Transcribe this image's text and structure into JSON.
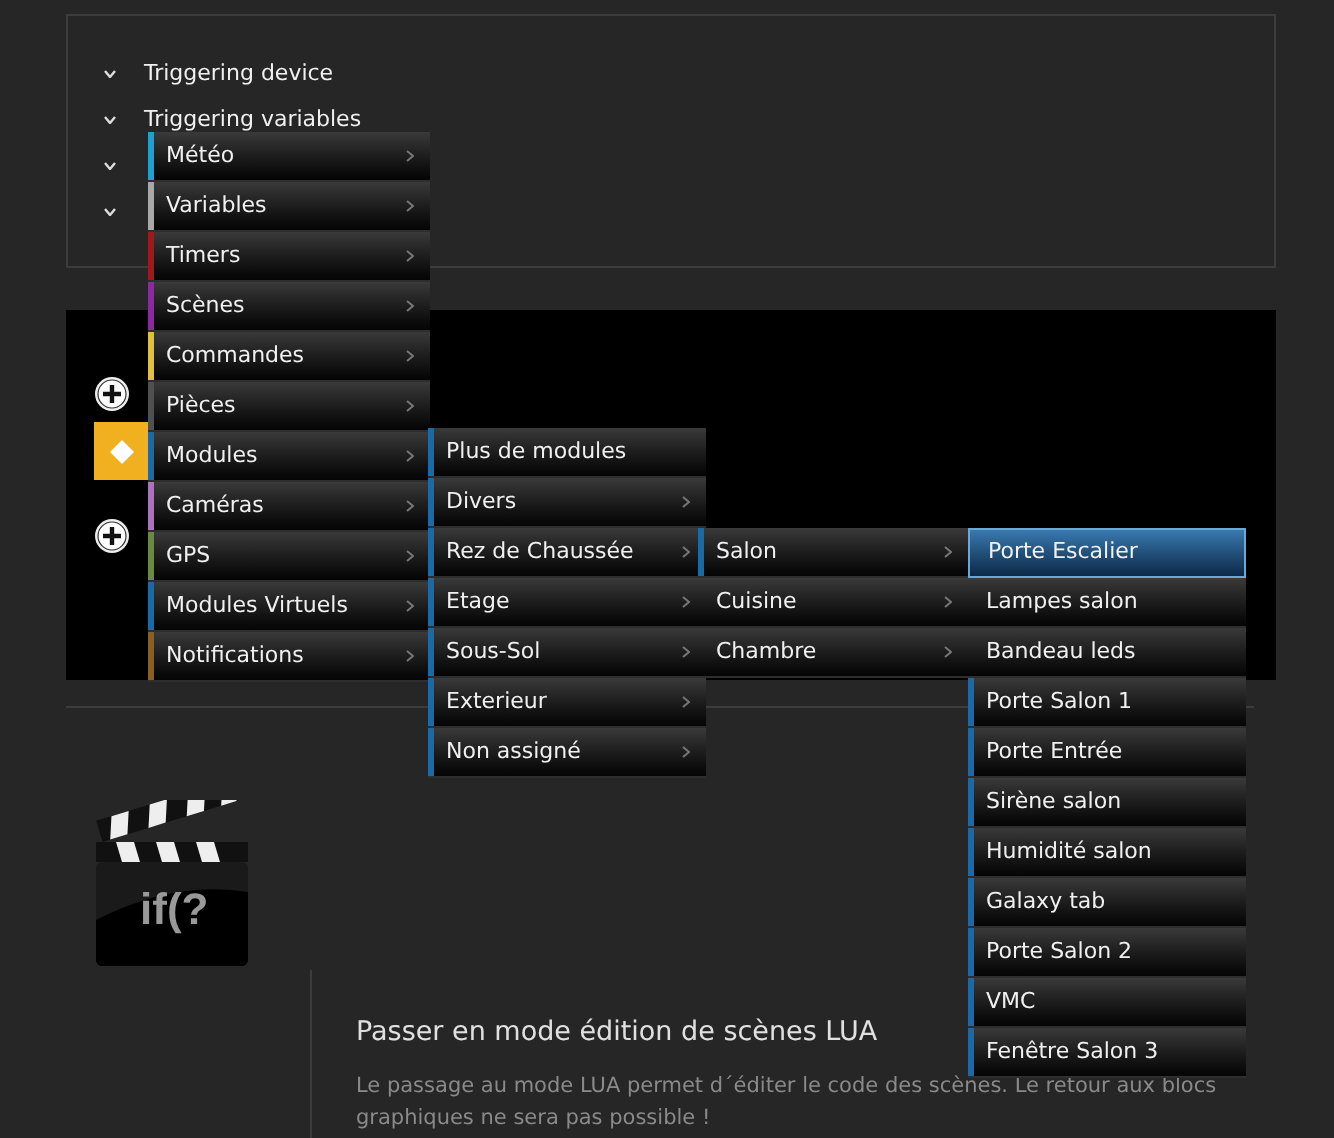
{
  "trigger_rows": [
    {
      "kind": "label",
      "label": "Triggering device"
    },
    {
      "kind": "label",
      "label": "Triggering variables"
    },
    {
      "kind": "covered"
    },
    {
      "kind": "covered"
    }
  ],
  "menus": [
    {
      "items": [
        {
          "label": "Météo",
          "color": "#1fa0d0",
          "has_submenu": true,
          "selected": false
        },
        {
          "label": "Variables",
          "color": "#a8a8a8",
          "has_submenu": true,
          "selected": false
        },
        {
          "label": "Timers",
          "color": "#a01818",
          "has_submenu": true,
          "selected": false
        },
        {
          "label": "Scènes",
          "color": "#8b2aa0",
          "has_submenu": true,
          "selected": false
        },
        {
          "label": "Commandes",
          "color": "#e0c040",
          "has_submenu": true,
          "selected": false
        },
        {
          "label": "Pièces",
          "color": "#505050",
          "has_submenu": true,
          "selected": false
        },
        {
          "label": "Modules",
          "color": "#1a6aa8",
          "has_submenu": true,
          "selected": false
        },
        {
          "label": "Caméras",
          "color": "#b070c0",
          "has_submenu": true,
          "selected": false
        },
        {
          "label": "GPS",
          "color": "#6a8a40",
          "has_submenu": true,
          "selected": false
        },
        {
          "label": "Modules Virtuels",
          "color": "#1a6aa8",
          "has_submenu": true,
          "selected": false
        },
        {
          "label": "Notifications",
          "color": "#8a6020",
          "has_submenu": true,
          "selected": false
        }
      ]
    },
    {
      "items": [
        {
          "label": "Plus de modules",
          "color": "#1a6aa8",
          "has_submenu": false,
          "selected": false
        },
        {
          "label": "Divers",
          "color": "#1a6aa8",
          "has_submenu": true,
          "selected": false
        },
        {
          "label": "Rez de Chaussée",
          "color": "#1a6aa8",
          "has_submenu": true,
          "selected": false
        },
        {
          "label": "Etage",
          "color": "#1a6aa8",
          "has_submenu": true,
          "selected": false
        },
        {
          "label": "Sous-Sol",
          "color": "#1a6aa8",
          "has_submenu": true,
          "selected": false
        },
        {
          "label": "Exterieur",
          "color": "#1a6aa8",
          "has_submenu": true,
          "selected": false
        },
        {
          "label": "Non assigné",
          "color": "#1a6aa8",
          "has_submenu": true,
          "selected": false
        }
      ]
    },
    {
      "items": [
        {
          "label": "Salon",
          "color": "#1a6aa8",
          "has_submenu": true,
          "selected": false
        },
        {
          "label": "Cuisine",
          "has_submenu": true,
          "selected": false
        },
        {
          "label": "Chambre",
          "has_submenu": true,
          "selected": false
        }
      ]
    },
    {
      "items": [
        {
          "label": "Porte Escalier",
          "has_submenu": false,
          "selected": true
        },
        {
          "label": "Lampes salon",
          "has_submenu": false,
          "selected": false
        },
        {
          "label": "Bandeau leds",
          "has_submenu": false,
          "selected": false
        },
        {
          "label": "Porte Salon 1",
          "color": "#1a6aa8",
          "has_submenu": false,
          "selected": false
        },
        {
          "label": "Porte Entrée",
          "color": "#1a6aa8",
          "has_submenu": false,
          "selected": false
        },
        {
          "label": "Sirène salon",
          "color": "#1a6aa8",
          "has_submenu": false,
          "selected": false
        },
        {
          "label": "Humidité salon",
          "color": "#1a6aa8",
          "has_submenu": false,
          "selected": false
        },
        {
          "label": "Galaxy tab",
          "color": "#1a6aa8",
          "has_submenu": false,
          "selected": false
        },
        {
          "label": "Porte Salon 2",
          "color": "#1a6aa8",
          "has_submenu": false,
          "selected": false
        },
        {
          "label": "VMC",
          "color": "#1a6aa8",
          "has_submenu": false,
          "selected": false
        },
        {
          "label": "Fenêtre Salon 3",
          "color": "#1a6aa8",
          "has_submenu": false,
          "selected": false
        }
      ]
    }
  ],
  "lua": {
    "icon_text": "if(?",
    "title": "Passer en mode édition de scènes LUA",
    "description": "Le passage au mode LUA permet d´éditer le code des scènes. Le retour aux blocs graphiques ne sera pas possible !"
  }
}
